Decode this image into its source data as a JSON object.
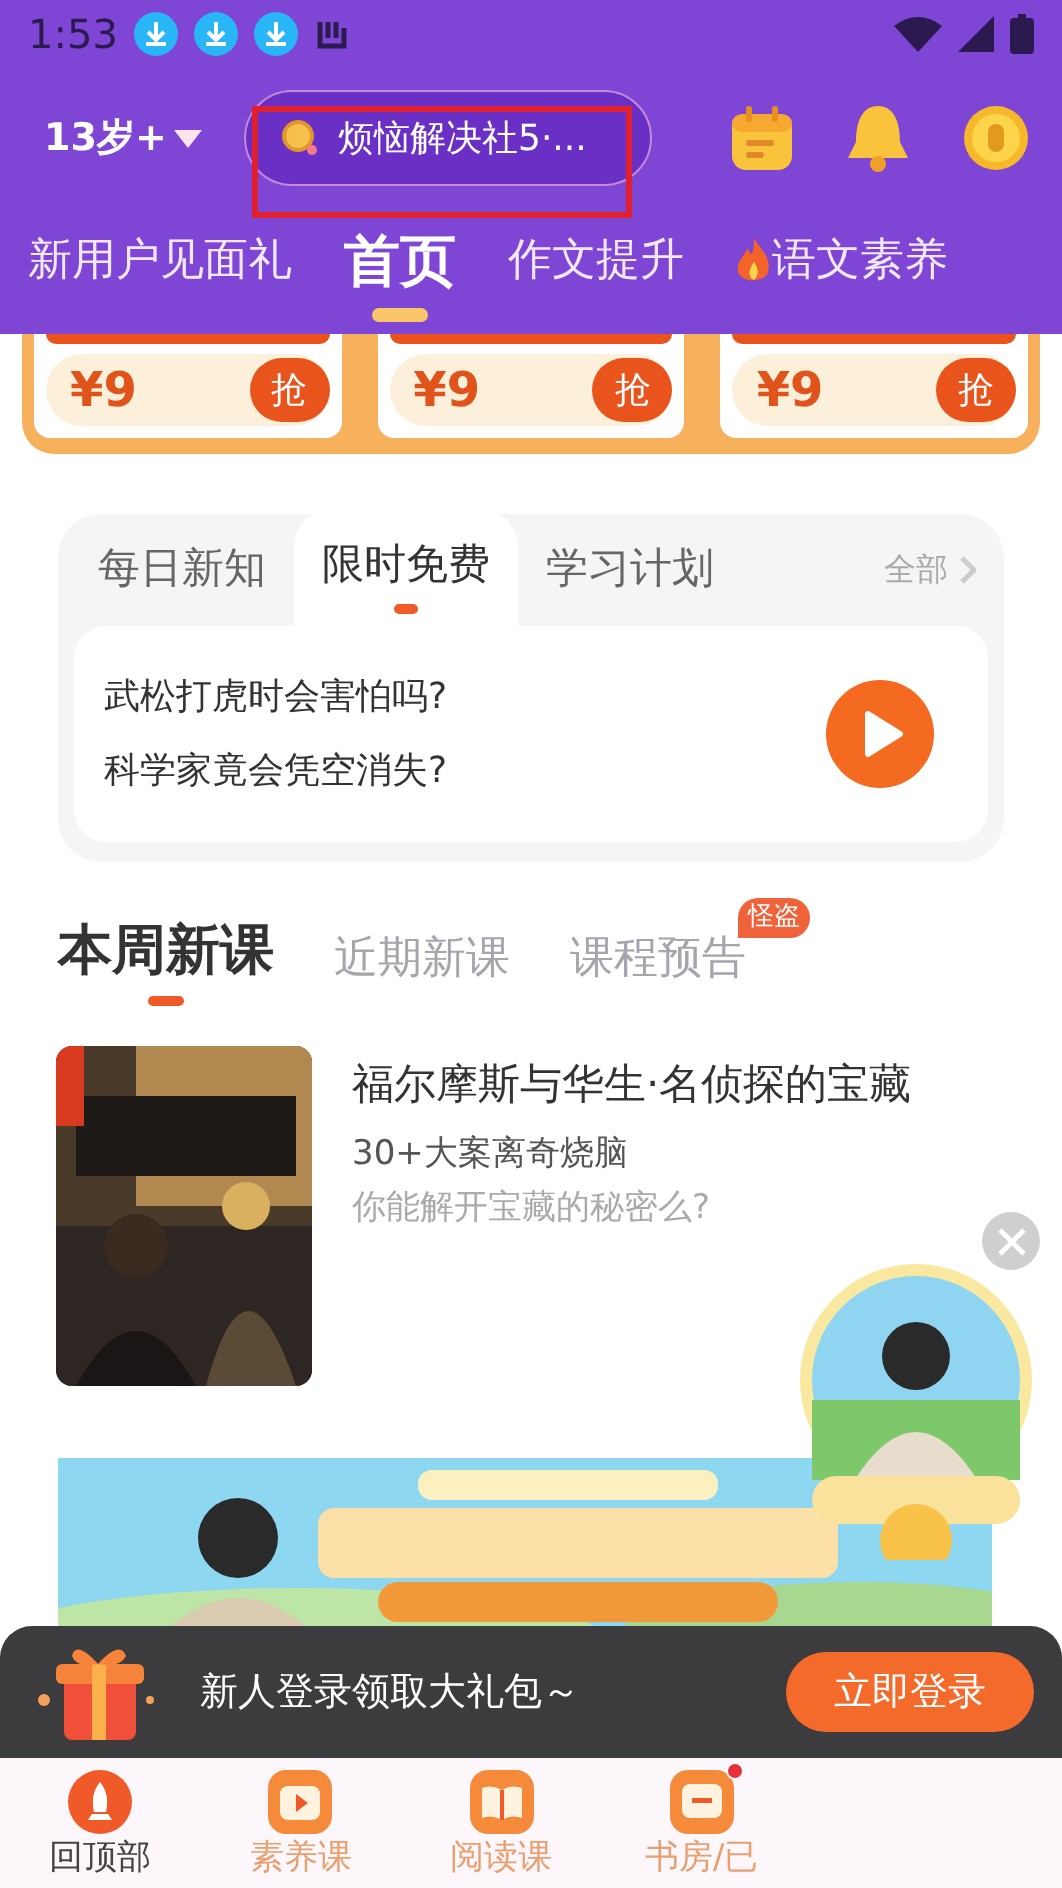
{
  "status_bar": {
    "time": "1:53"
  },
  "header": {
    "age": "13岁+",
    "search": {
      "placeholder": "烦恼解决社5·..."
    }
  },
  "top_tabs": [
    {
      "label": "新用户见面礼",
      "selected": false,
      "hot": false
    },
    {
      "label": "首页",
      "selected": true,
      "hot": false
    },
    {
      "label": "作文提升",
      "selected": false,
      "hot": false
    },
    {
      "label": "语文素养",
      "selected": false,
      "hot": true
    }
  ],
  "deals": [
    {
      "price": "¥9",
      "button": "抢"
    },
    {
      "price": "¥9",
      "button": "抢"
    },
    {
      "price": "¥9",
      "button": "抢"
    }
  ],
  "daily": {
    "tabs": [
      {
        "label": "每日新知",
        "selected": false
      },
      {
        "label": "限时免费",
        "selected": true
      },
      {
        "label": "学习计划",
        "selected": false
      }
    ],
    "all": "全部",
    "lines": [
      "武松打虎时会害怕吗?",
      "科学家竟会凭空消失?"
    ]
  },
  "course_tabs": [
    {
      "label": "本周新课",
      "selected": true
    },
    {
      "label": "近期新课",
      "selected": false
    },
    {
      "label": "课程预告",
      "selected": false,
      "badge": "怪盗"
    }
  ],
  "course": {
    "title": "福尔摩斯与华生·名侦探的宝藏",
    "subtitle": "30+大案离奇烧脑",
    "description": "你能解开宝藏的秘密么?"
  },
  "login_bar": {
    "text": "新人登录领取大礼包～",
    "button": "立即登录"
  },
  "bottom_nav": [
    {
      "label": "回顶部",
      "selected": true,
      "badge": false
    },
    {
      "label": "素养课",
      "selected": false,
      "badge": false
    },
    {
      "label": "阅读课",
      "selected": false,
      "badge": false
    },
    {
      "label": "书房/已",
      "selected": false,
      "badge": true
    }
  ]
}
